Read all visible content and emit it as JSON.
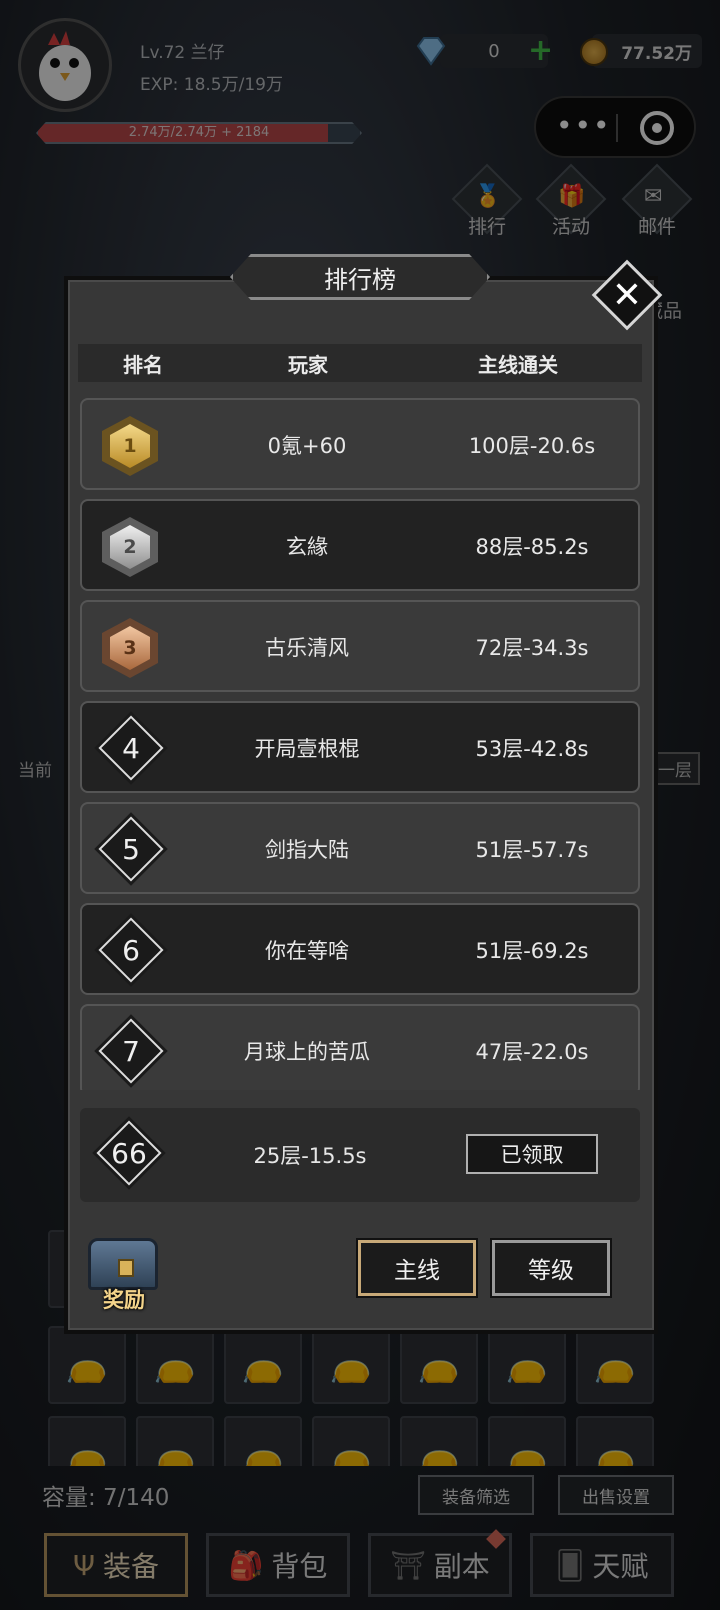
{
  "player": {
    "name_level": "Lv.72 兰仔",
    "exp": "EXP: 18.5万/19万",
    "hp": "2.74万/2.74万 + 2184",
    "hp_fraction": 0.9
  },
  "currency": {
    "gems": "0",
    "gold": "77.52万"
  },
  "side_menu": {
    "rank": "排行",
    "events": "活动",
    "mail": "邮件",
    "collection": "藏品"
  },
  "background": {
    "current_label": "当前",
    "floor_label": "一层"
  },
  "dialog": {
    "title": "排行榜",
    "headers": {
      "rank": "排名",
      "player": "玩家",
      "progress": "主线通关"
    },
    "rows": [
      {
        "rank": "1",
        "player": "0氪+60",
        "score": "100层-20.6s"
      },
      {
        "rank": "2",
        "player": "玄緣",
        "score": "88层-85.2s"
      },
      {
        "rank": "3",
        "player": "古乐清风",
        "score": "72层-34.3s"
      },
      {
        "rank": "4",
        "player": "开局壹根棍",
        "score": "53层-42.8s"
      },
      {
        "rank": "5",
        "player": "剑指大陆",
        "score": "51层-57.7s"
      },
      {
        "rank": "6",
        "player": "你在等啥",
        "score": "51层-69.2s"
      },
      {
        "rank": "7",
        "player": "月球上的苦瓜",
        "score": "47层-22.0s"
      }
    ],
    "my_rank": {
      "rank": "66",
      "score": "25层-15.5s",
      "status_button": "已领取"
    },
    "reward_label": "奖励",
    "tab_main": "主线",
    "tab_level": "等级"
  },
  "inventory": {
    "capacity": "容量: 7/140",
    "filter_button": "装备筛选",
    "sell_button": "出售设置"
  },
  "bottom_tabs": {
    "equipment": "装备",
    "backpack": "背包",
    "dungeon": "副本",
    "talent": "天赋"
  },
  "colors": {
    "gold_medal": "#d9b247",
    "silver_medal": "#b8b8b8",
    "bronze_medal": "#c58a5c",
    "hp_fill": "#b8474a",
    "plus_green": "#44c04a"
  }
}
